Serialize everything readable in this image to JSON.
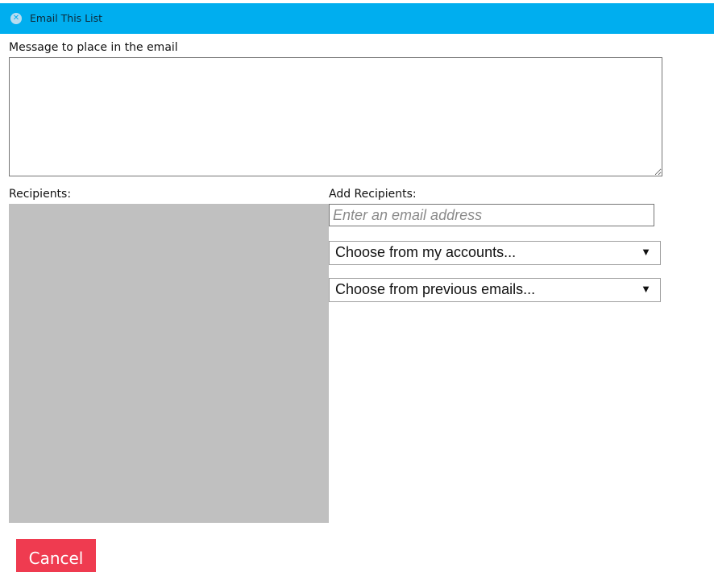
{
  "dialog": {
    "title": "Email This List",
    "close_icon": "close-circle-icon",
    "accent_color": "#00aeef"
  },
  "message": {
    "label": "Message to place in the email",
    "value": ""
  },
  "recipients": {
    "label": "Recipients:",
    "items": []
  },
  "add_recipients": {
    "label": "Add Recipients:",
    "email_placeholder": "Enter an email address",
    "accounts_select": {
      "selected": "Choose from my accounts..."
    },
    "previous_select": {
      "selected": "Choose from previous emails..."
    }
  },
  "actions": {
    "cancel_label": "Cancel",
    "cancel_color": "#ef3b50"
  }
}
